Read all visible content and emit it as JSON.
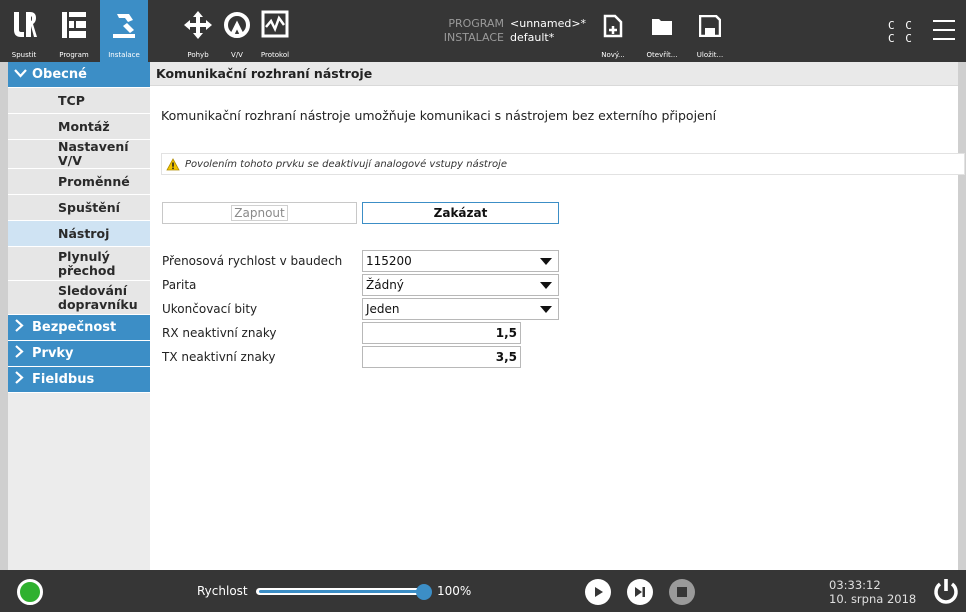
{
  "topbar": {
    "tabs": [
      {
        "label": "Spustit",
        "icon": "ur-logo-icon"
      },
      {
        "label": "Program",
        "icon": "program-icon"
      },
      {
        "label": "Instalace",
        "icon": "installation-icon"
      }
    ],
    "tools": [
      {
        "label": "Pohyb",
        "icon": "move-icon"
      },
      {
        "label": "V/V",
        "icon": "io-icon"
      },
      {
        "label": "Protokol",
        "icon": "log-icon"
      }
    ],
    "program_key": "PROGRAM",
    "program_value": "<unnamed>*",
    "install_key": "INSTALACE",
    "install_value": "default*",
    "file_actions": [
      {
        "label": "Nový...",
        "icon": "new-file-icon"
      },
      {
        "label": "Otevřít...",
        "icon": "open-folder-icon"
      },
      {
        "label": "Uložit...",
        "icon": "save-icon"
      }
    ],
    "cc_line1": "C C",
    "cc_line2": "C C"
  },
  "sidebar": {
    "category_general": "Obecné",
    "items": [
      "TCP",
      "Montáž",
      "Nastavení V/V",
      "Proměnné",
      "Spuštění",
      "Nástroj",
      "Plynulý přechod",
      "Sledování dopravníku"
    ],
    "selected": "Nástroj",
    "category_safety": "Bezpečnost",
    "category_features": "Prvky",
    "category_fieldbus": "Fieldbus"
  },
  "main": {
    "header": "Komunikační rozhraní nástroje",
    "description": "Komunikační rozhraní nástroje umožňuje komunikaci s nástrojem bez externího připojení",
    "warning": "Povolením tohoto prvku se deaktivují analogové vstupy nástroje",
    "enable_label": "Zapnout",
    "disable_label": "Zakázat",
    "baud_label": "Přenosová rychlost v baudech",
    "baud_value": "115200",
    "parity_label": "Parita",
    "parity_value": "Žádný",
    "stopbits_label": "Ukončovací bity",
    "stopbits_value": "Jeden",
    "rx_label": "RX neaktivní znaky",
    "rx_value": "1,5",
    "tx_label": "TX neaktivní znaky",
    "tx_value": "3,5"
  },
  "bottombar": {
    "speed_label": "Rychlost",
    "speed_percent": "100%",
    "speed_fraction": 1.0,
    "time": "03:33:12",
    "date": "10. srpna 2018",
    "status_color": "#2fb12f"
  },
  "colors": {
    "accent": "#3c8ec6",
    "topbar": "#363636",
    "selected": "#cfe3f3"
  }
}
